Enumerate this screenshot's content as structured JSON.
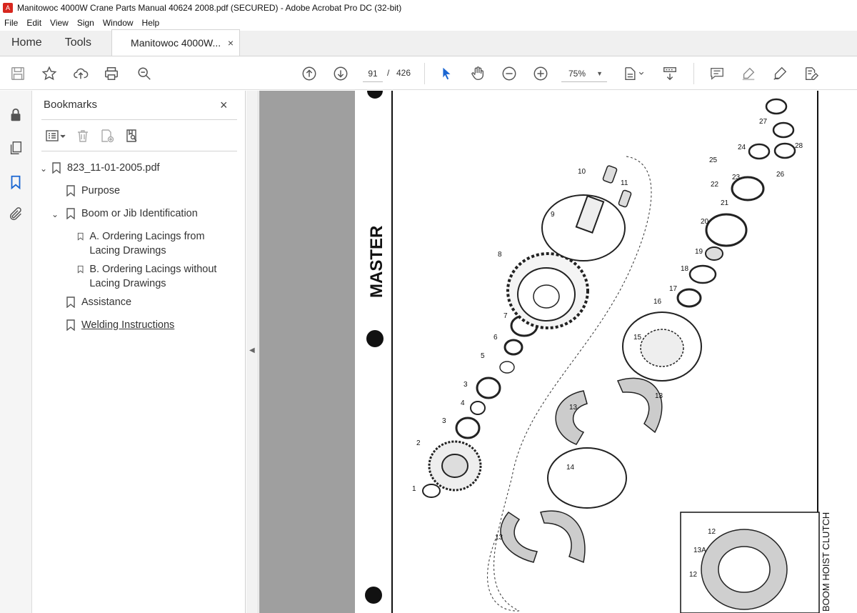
{
  "window": {
    "title": "Manitowoc 4000W Crane Parts Manual 40624 2008.pdf (SECURED) - Adobe Acrobat Pro DC (32-bit)"
  },
  "menu": [
    "File",
    "Edit",
    "View",
    "Sign",
    "Window",
    "Help"
  ],
  "tabs": {
    "home": "Home",
    "tools": "Tools",
    "document": "Manitowoc 4000W...",
    "close": "×"
  },
  "toolbar": {
    "current_page": "91",
    "page_separator": "/",
    "total_pages": "426",
    "zoom": "75%"
  },
  "bookmarks": {
    "header": "Bookmarks",
    "close": "×",
    "items": [
      {
        "label": "823_11-01-2005.pdf"
      },
      {
        "label": "Purpose"
      },
      {
        "label": "Boom or Jib Identification"
      },
      {
        "label": "A. Ordering Lacings from Lacing Drawings"
      },
      {
        "label": "B. Ordering Lacings without Lacing Drawings"
      },
      {
        "label": "Assistance"
      },
      {
        "label": "Welding Instructions"
      }
    ]
  },
  "page_content": {
    "master_stamp": "MASTER",
    "inset_title": "BOOM HOIST CLUTCH",
    "callouts": [
      "1",
      "2",
      "3",
      "3",
      "4",
      "5",
      "6",
      "7",
      "8",
      "9",
      "10",
      "11",
      "13",
      "13",
      "13",
      "14",
      "15",
      "16",
      "17",
      "18",
      "19",
      "20",
      "21",
      "22",
      "23",
      "24",
      "25",
      "26",
      "27",
      "28",
      "12",
      "12",
      "13A"
    ]
  }
}
